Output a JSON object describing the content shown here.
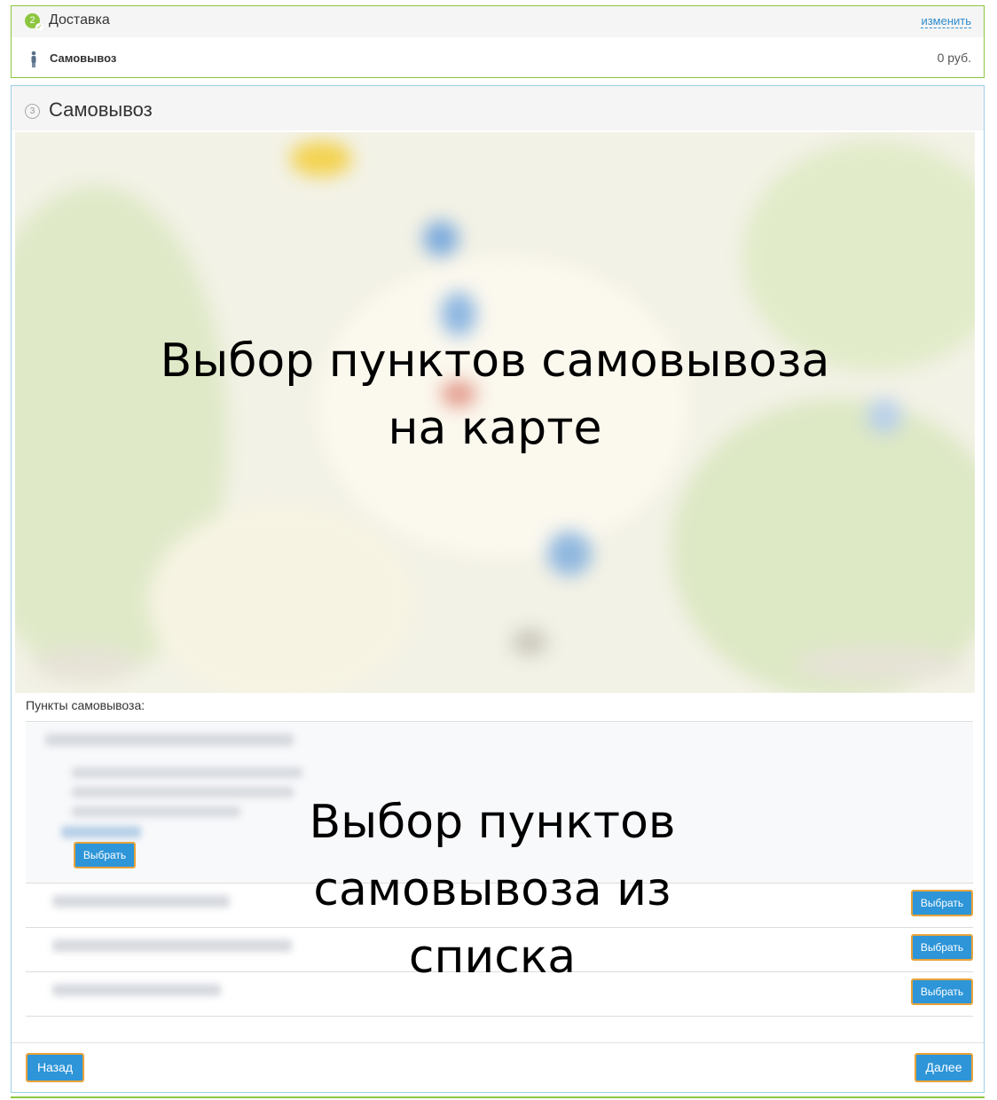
{
  "delivery": {
    "step_number": "2",
    "title": "Доставка",
    "change_link": "изменить",
    "method": "Самовывоз",
    "price": "0 руб."
  },
  "pickup": {
    "step_number": "3",
    "title": "Самовывоз",
    "map_caption_line1": "Выбор пунктов самовывоза",
    "map_caption_line2": "на карте",
    "list_label": "Пункты самовывоза:",
    "list_caption_line1": "Выбор пунктов",
    "list_caption_line2": "самовывоза из",
    "list_caption_line3": "списка",
    "select_label": "Выбрать"
  },
  "nav": {
    "back_label": "Назад",
    "next_label": "Далее"
  },
  "colors": {
    "accent_green": "#8cc63f",
    "button_blue": "#2d95d8",
    "button_border": "#e8a33a",
    "link_blue": "#2d8ccf"
  },
  "icons": {
    "step_done": "check-circle-icon",
    "person": "person-icon"
  }
}
